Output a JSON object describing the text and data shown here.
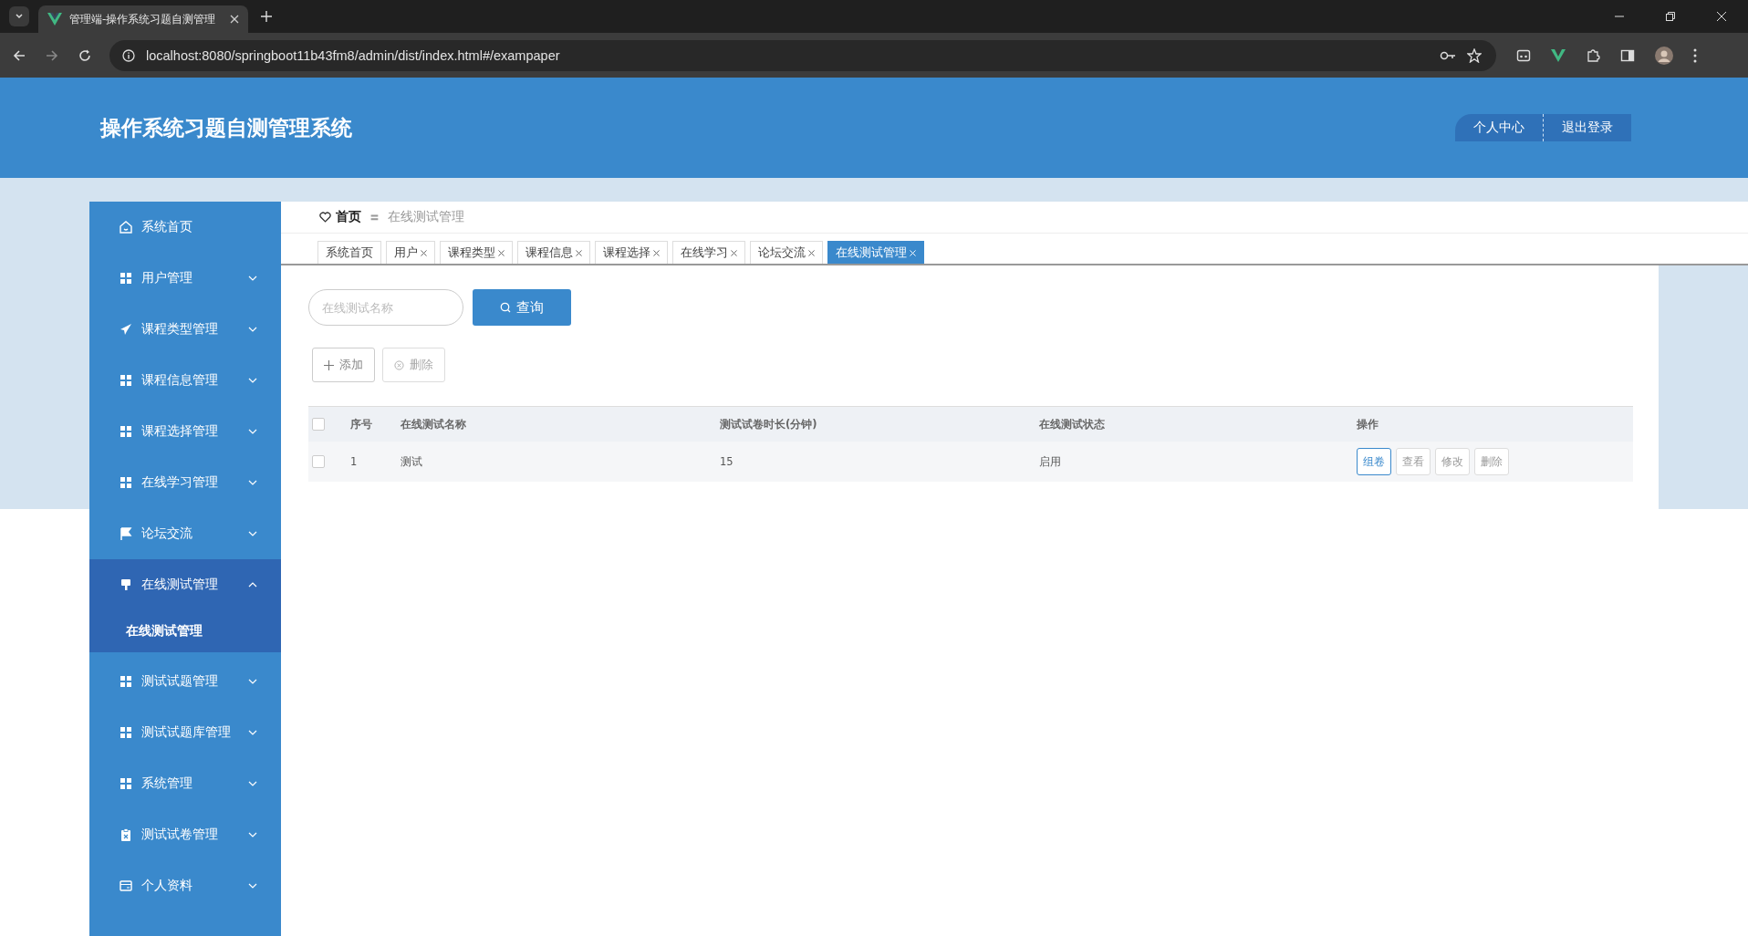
{
  "browser": {
    "tab_title": "管理端-操作系统习题自测管理",
    "url": "localhost:8080/springboot11b43fm8/admin/dist/index.html#/exampaper"
  },
  "header": {
    "title": "操作系统习题自测管理系统",
    "buttons": [
      "个人中心",
      "退出登录"
    ]
  },
  "sidebar": {
    "items": [
      {
        "label": "系统首页",
        "kind": "home",
        "expanded": false
      },
      {
        "label": "用户管理",
        "kind": "grid",
        "expanded": false,
        "has_arrow": true
      },
      {
        "label": "课程类型管理",
        "kind": "plane",
        "expanded": false,
        "has_arrow": true
      },
      {
        "label": "课程信息管理",
        "kind": "grid",
        "expanded": false,
        "has_arrow": true
      },
      {
        "label": "课程选择管理",
        "kind": "grid",
        "expanded": false,
        "has_arrow": true
      },
      {
        "label": "在线学习管理",
        "kind": "grid",
        "expanded": false,
        "has_arrow": true
      },
      {
        "label": "论坛交流",
        "kind": "flag",
        "expanded": false,
        "has_arrow": true
      },
      {
        "label": "在线测试管理",
        "kind": "brush",
        "expanded": true,
        "has_arrow": true,
        "children": [
          {
            "label": "在线测试管理",
            "selected": true
          }
        ]
      },
      {
        "label": "测试试题管理",
        "kind": "grid",
        "expanded": false,
        "has_arrow": true
      },
      {
        "label": "测试试题库管理",
        "kind": "grid",
        "expanded": false,
        "has_arrow": true
      },
      {
        "label": "系统管理",
        "kind": "grid",
        "expanded": false,
        "has_arrow": true
      },
      {
        "label": "测试试卷管理",
        "kind": "clipboard",
        "expanded": false,
        "has_arrow": true
      },
      {
        "label": "个人资料",
        "kind": "card",
        "expanded": false,
        "has_arrow": true
      }
    ]
  },
  "breadcrumb": {
    "home": "首页",
    "separator": "〓",
    "current": "在线测试管理"
  },
  "tabs": [
    {
      "label": "系统首页",
      "closable": false,
      "selected": false
    },
    {
      "label": "用户",
      "closable": true,
      "selected": false
    },
    {
      "label": "课程类型",
      "closable": true,
      "selected": false
    },
    {
      "label": "课程信息",
      "closable": true,
      "selected": false
    },
    {
      "label": "课程选择",
      "closable": true,
      "selected": false
    },
    {
      "label": "在线学习",
      "closable": true,
      "selected": false
    },
    {
      "label": "论坛交流",
      "closable": true,
      "selected": false
    },
    {
      "label": "在线测试管理",
      "closable": true,
      "selected": true
    }
  ],
  "search": {
    "placeholder": "在线测试名称",
    "button": "查询"
  },
  "actions": [
    {
      "label": "添加",
      "kind": "add"
    },
    {
      "label": "删除",
      "kind": "delete"
    }
  ],
  "table": {
    "header_checked": false,
    "columns": [
      "序号",
      "在线测试名称",
      "测试试卷时长(分钟)",
      "在线测试状态",
      "操作"
    ],
    "rows": [
      {
        "checked": false,
        "cells": [
          "1",
          "测试",
          "15",
          "启用"
        ],
        "actions": [
          {
            "label": "组卷",
            "selected": true
          },
          {
            "label": "查看",
            "selected": false
          },
          {
            "label": "修改",
            "selected": false
          },
          {
            "label": "删除",
            "selected": false
          }
        ]
      }
    ]
  }
}
